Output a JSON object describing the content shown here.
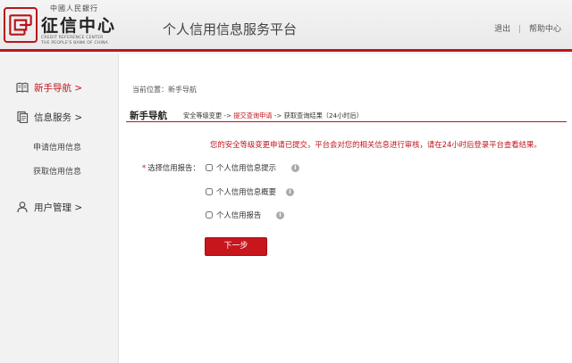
{
  "header": {
    "logo_top": "中國人民銀行",
    "logo_main": "征信中心",
    "logo_en1": "CREDIT REFERENCE CENTER",
    "logo_en2": "THE PEOPLE'S BANK OF CHINA",
    "platform_title": "个人信用信息服务平台",
    "logout": "退出",
    "separator": "|",
    "help": "帮助中心"
  },
  "sidebar": {
    "items": [
      {
        "label": "新手导航 >",
        "icon": "book-icon",
        "active": true
      },
      {
        "label": "信息服务 >",
        "icon": "document-icon",
        "active": false
      },
      {
        "label": "用户管理 >",
        "icon": "user-icon",
        "active": false
      }
    ],
    "subitems": [
      {
        "label": "申请信用信息"
      },
      {
        "label": "获取信用信息"
      }
    ]
  },
  "main": {
    "breadcrumb": "当前位置：新手导航",
    "step_title": "新手导航",
    "steps": {
      "step1": "安全等级变更 -> ",
      "step2": "提交查询申请",
      "step3": " -> 获取查询结果（24小时后）"
    },
    "notice": "您的安全等级变更申请已提交，平台会对您的相关信息进行审核，请在24小时后登录平台查看结果。",
    "form": {
      "required_mark": "*",
      "label": "选择信用报告：",
      "options": [
        {
          "label": "个人信用信息提示",
          "checked": false
        },
        {
          "label": "个人信用信息概要",
          "checked": false
        },
        {
          "label": "个人信用报告",
          "checked": false
        }
      ],
      "info_glyph": "i"
    },
    "next_button": "下一步"
  },
  "colors": {
    "accent": "#c0141b",
    "button": "#c8161d"
  }
}
